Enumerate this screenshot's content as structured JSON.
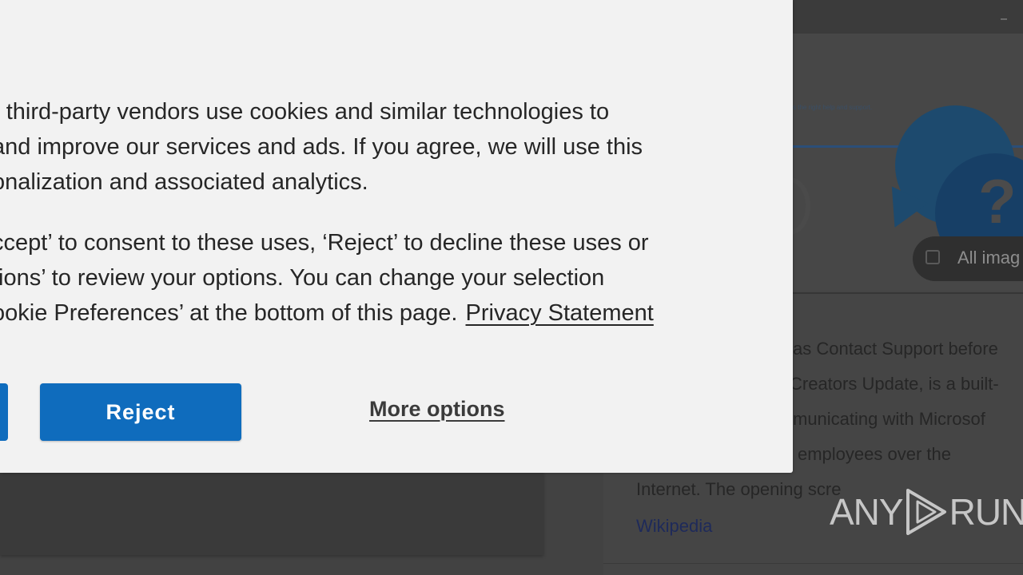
{
  "cookie_dialog": {
    "paragraph1_lines": [
      "r third-party vendors use cookies and similar technologies to",
      "and improve our services and ads. If you agree, we will use this",
      "onalization and associated analytics."
    ],
    "paragraph2_lines": [
      "ccept’ to consent to these uses, ‘Reject’ to decline these uses or",
      "tions’ to review your options. You can change your selection",
      "ookie Preferences’ at the bottom of this page."
    ],
    "privacy_link": "Privacy Statement",
    "reject_label": "Reject",
    "more_options_label": "More options"
  },
  "background": {
    "all_images_label": "All imag",
    "hero_small_text": "s the right help and support.",
    "description_lines": [
      "as Contact Support before",
      "Creators Update, is a built-",
      "municating with Microsof",
      "employees over the",
      "Internet. The opening scre"
    ],
    "source_link": "Wikipedia",
    "colors": {
      "accent_blue": "#0f6cbd",
      "overlay_dark": "#424242",
      "dialog_bg": "#f2f2f2"
    }
  },
  "watermark": {
    "left_text": "ANY",
    "right_text": "RUN"
  }
}
